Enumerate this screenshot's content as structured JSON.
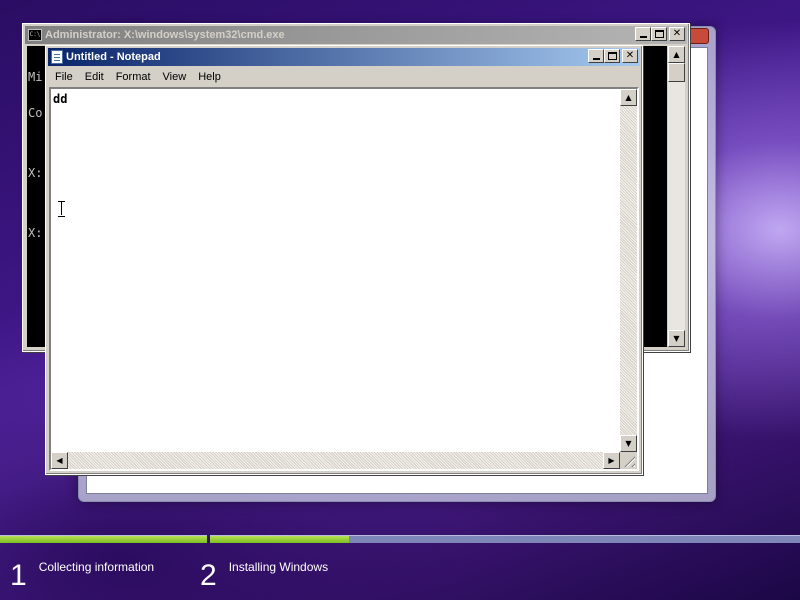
{
  "cmd_window": {
    "title": "Administrator: X:\\windows\\system32\\cmd.exe",
    "console_lines": [
      "Mi",
      "Co",
      "",
      "X:",
      "",
      "X:"
    ]
  },
  "notepad": {
    "title": "Untitled - Notepad",
    "menu": [
      "File",
      "Edit",
      "Format",
      "View",
      "Help"
    ],
    "text": "dd"
  },
  "setup": {
    "progress": [
      {
        "fraction": 1.0
      },
      {
        "fraction": 0.235
      }
    ],
    "steps": [
      {
        "number": "1",
        "label": "Collecting information"
      },
      {
        "number": "2",
        "label": "Installing Windows"
      }
    ]
  },
  "icons": {
    "cmd": "cmd-icon",
    "notepad": "notepad-icon"
  }
}
